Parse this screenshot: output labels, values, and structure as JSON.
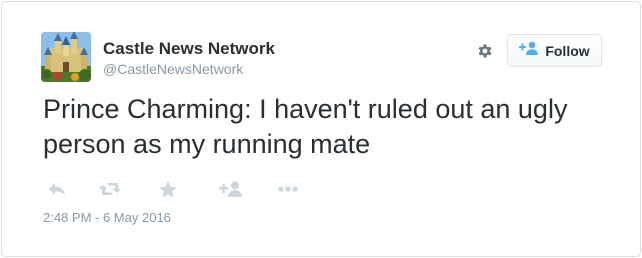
{
  "colors": {
    "text_primary": "#292f33",
    "text_secondary": "#8899a6",
    "icon_gray": "#ccd6dd",
    "accent_blue": "#55acee",
    "card_border": "#d8dfe4"
  },
  "user": {
    "display_name": "Castle News Network",
    "handle": "@CastleNewsNetwork",
    "avatar_icon": "castle-avatar"
  },
  "header": {
    "settings_icon": "gear-icon",
    "follow_label": "Follow",
    "follow_icon": "add-user-icon"
  },
  "tweet": {
    "text": "Prince Charming: I haven't ruled out an ugly person as my running mate",
    "timestamp": "2:48 PM - 6 May 2016"
  },
  "actions": [
    {
      "icon": "reply-icon"
    },
    {
      "icon": "retweet-icon"
    },
    {
      "icon": "like-star-icon"
    },
    {
      "icon": "add-user-icon"
    },
    {
      "icon": "more-icon"
    }
  ]
}
